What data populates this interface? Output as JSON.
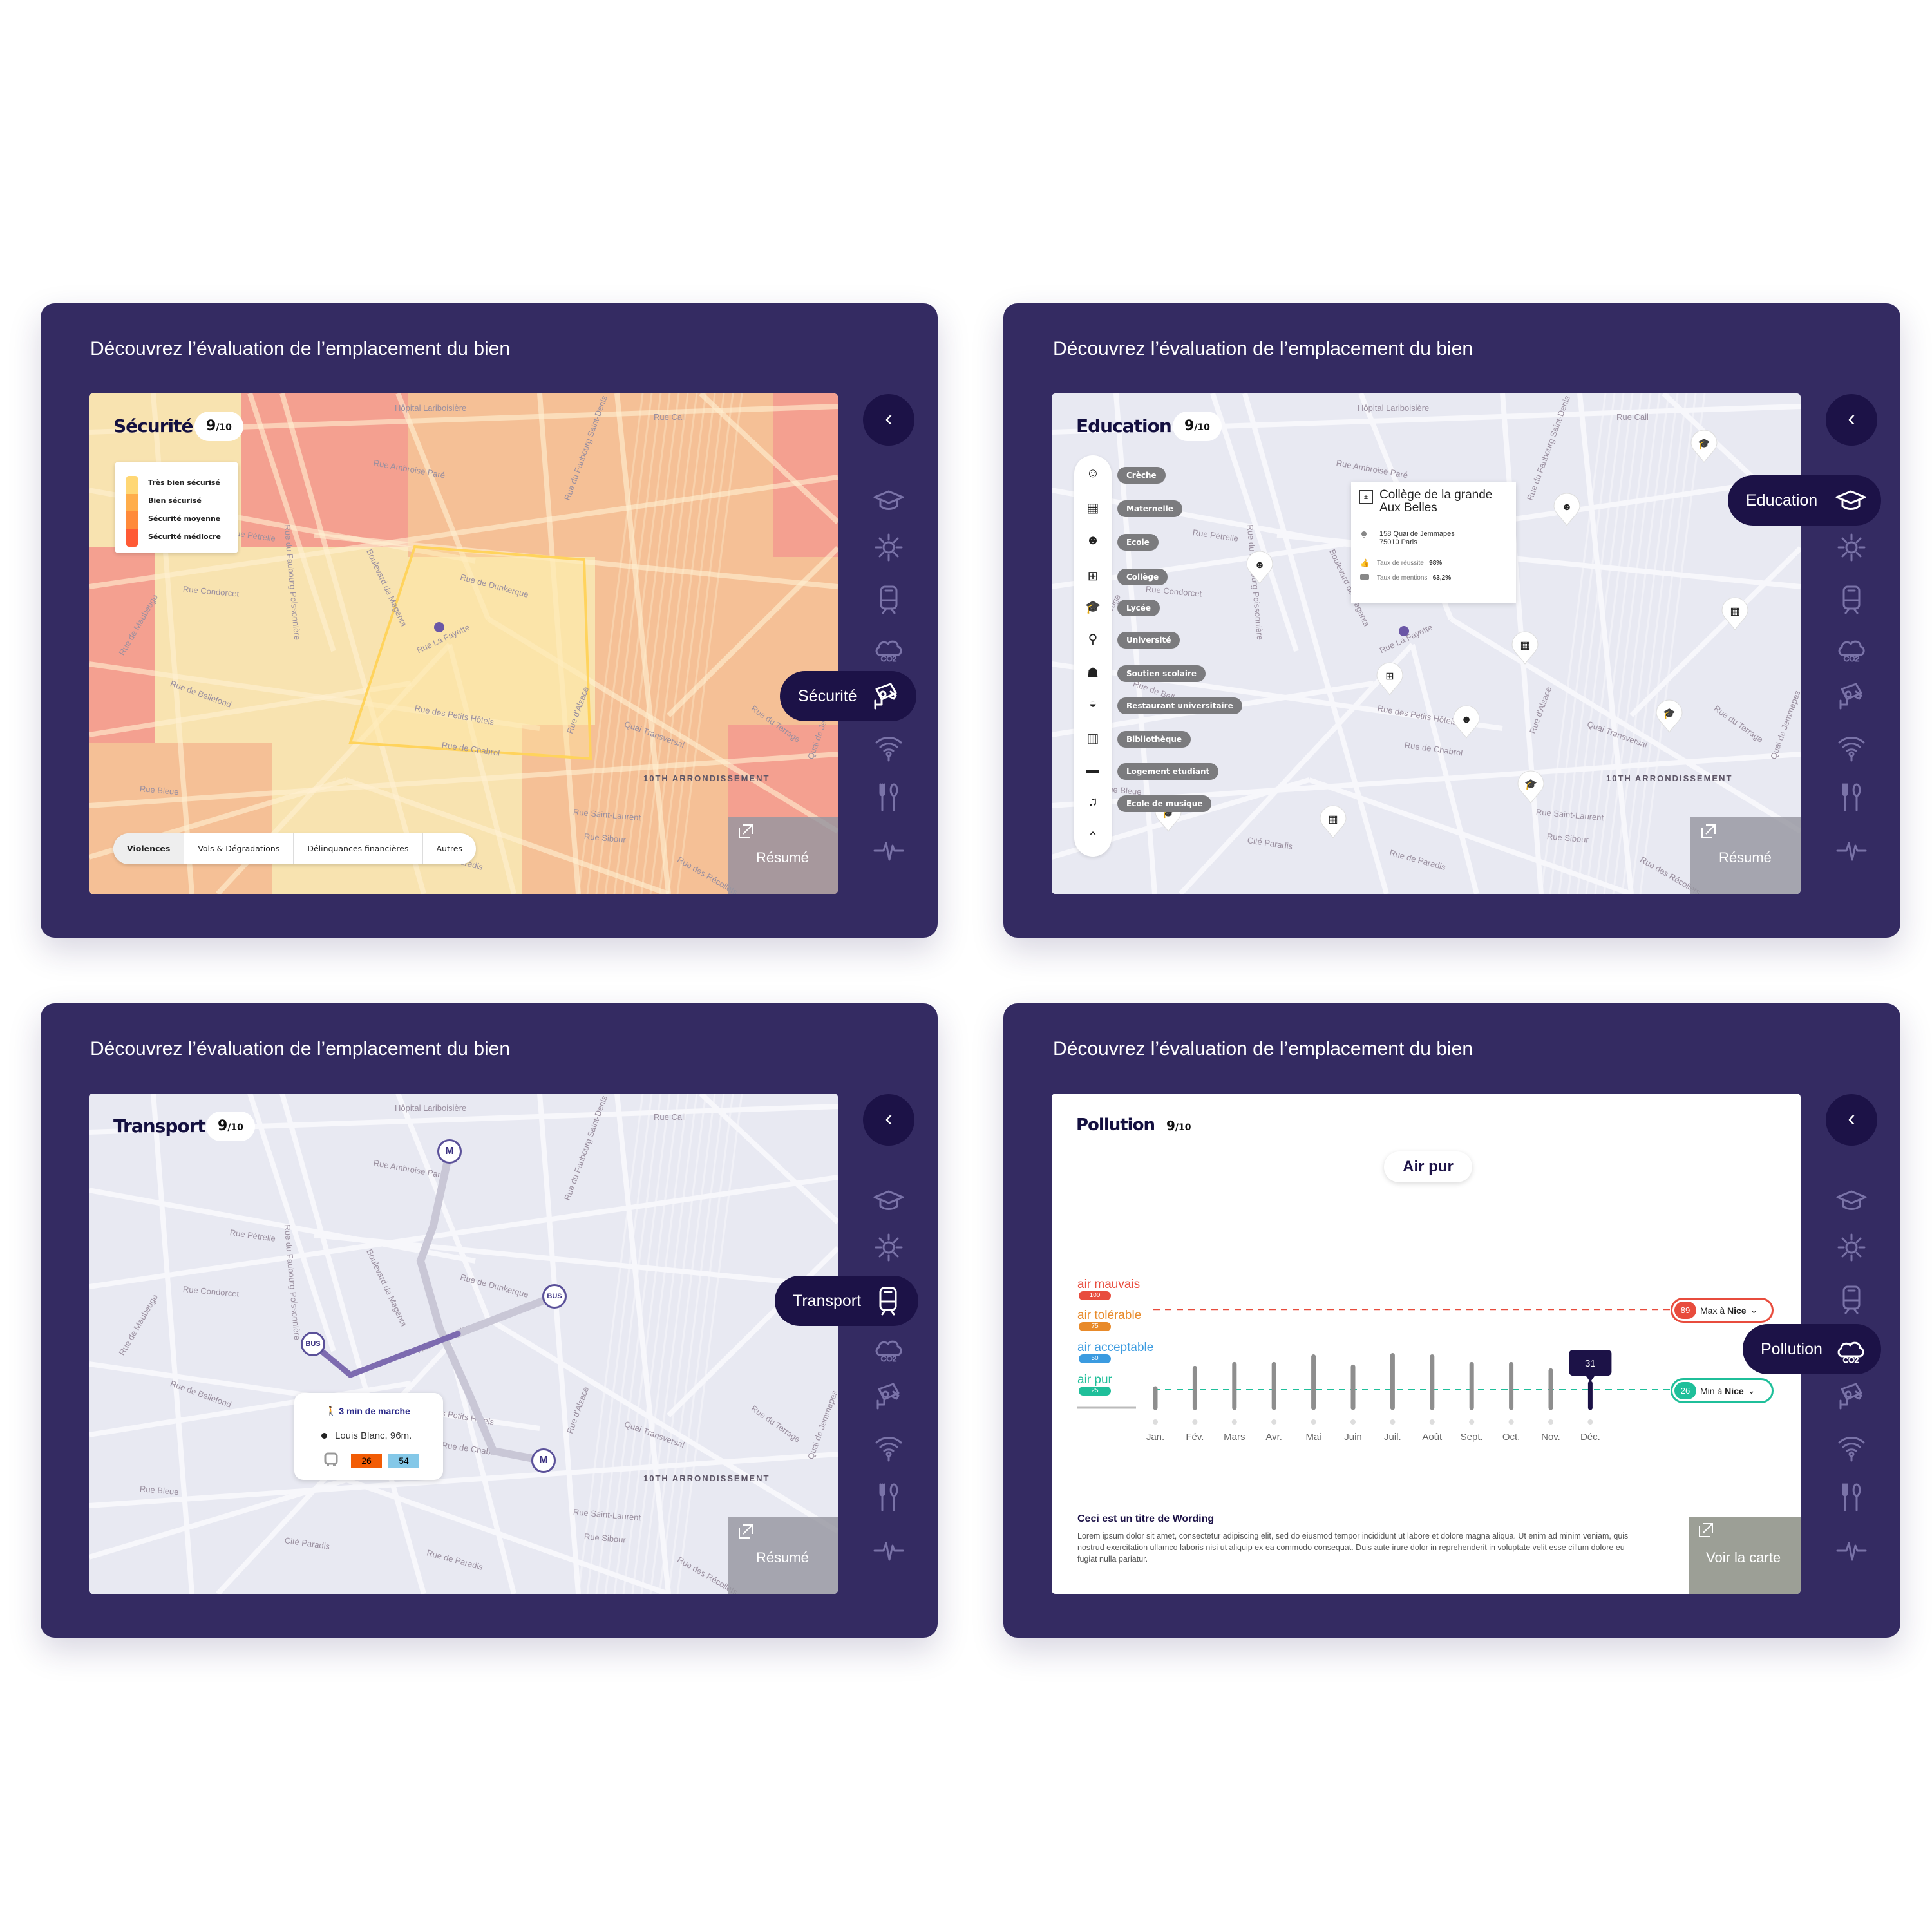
{
  "heading": "Découvrez l’évaluation de l’emplacement du bien",
  "colors": {
    "panel": "#342b62",
    "dark": "#1c1247",
    "icon": "#7a73a8",
    "bad": "#e84c3d",
    "tolerable": "#e88a2a",
    "acceptable": "#3b9be0",
    "pure": "#1fbf9a"
  },
  "sidebar_icons": [
    "graduation-cap-icon",
    "sun-icon",
    "train-icon",
    "cloud-co2-icon",
    "security-camera-icon",
    "wifi-icon",
    "fork-spoon-icon",
    "pulse-icon"
  ],
  "back_label": "‹",
  "resume_label": "Résumé",
  "map_labels": [
    "Hôpital Lariboisière",
    "Rue Ambroise Paré",
    "Boulevard de Magenta",
    "Rue La Fayette",
    "10TH ARRONDISSEMENT",
    "Rue de Chabrol",
    "Rue du Faubourg Poissonnière",
    "Rue Saint-Laurent",
    "Rue Sibour",
    "Rue des Récollets",
    "Rue de Dunkerque",
    "Rue Condorcet",
    "Rue de Maubeuge",
    "Rue de Bellefond",
    "Rue Bleue",
    "Rue des Petits Hôtels",
    "Rue de Paradis",
    "Cité Paradis",
    "Quai de Jemmapes",
    "Rue du Terrage",
    "Quai Transversal",
    "Rue d'Alsace",
    "Rue Cail",
    "Rue du Faubourg Saint-Denis",
    "Rue Pétrelle"
  ],
  "security": {
    "title": "Sécurité",
    "score": "9",
    "score_max": "/10",
    "active": "Sécurité",
    "active_icon": "security-camera-icon",
    "legend": [
      {
        "label": "Très bien sécurisé",
        "color": "#ffd774"
      },
      {
        "label": "Bien sécurisé",
        "color": "#ffad4a"
      },
      {
        "label": "Sécurité moyenne",
        "color": "#ff8a3a"
      },
      {
        "label": "Sécurité médiocre",
        "color": "#ff5a35"
      }
    ],
    "tabs": [
      "Violences",
      "Vols & Dégradations",
      "Délinquances financières",
      "Autres"
    ],
    "active_tab": "Violences"
  },
  "education": {
    "title": "Education",
    "score": "9",
    "score_max": "/10",
    "active": "Education",
    "active_icon": "graduation-cap-icon",
    "filters": [
      {
        "label": "Crèche",
        "icon": "baby-icon"
      },
      {
        "label": "Maternelle",
        "icon": "abc-blocks-icon"
      },
      {
        "label": "Ecole",
        "icon": "children-icon"
      },
      {
        "label": "Collège",
        "icon": "calculator-icon"
      },
      {
        "label": "Lycée",
        "icon": "graduation-cap-icon"
      },
      {
        "label": "Université",
        "icon": "diploma-icon"
      },
      {
        "label": "Soutien scolaire",
        "icon": "teacher-icon"
      },
      {
        "label": "Restaurant universitaire",
        "icon": "burger-icon"
      },
      {
        "label": "Bibliothèque",
        "icon": "books-icon"
      },
      {
        "label": "Logement etudiant",
        "icon": "bed-icon"
      },
      {
        "label": "Ecole de musique",
        "icon": "music-note-icon"
      }
    ],
    "popup": {
      "name": "Collège de la grande Aux Belles",
      "address1": "158 Quai de Jemmapes",
      "address2": "75010 Paris",
      "success_label": "Taux de réussite",
      "success_value": "98%",
      "mentions_label": "Taux de mentions",
      "mentions_value": "63,2%"
    }
  },
  "transport": {
    "title": "Transport",
    "score": "9",
    "score_max": "/10",
    "active": "Transport",
    "active_icon": "train-icon",
    "stops": [
      "M",
      "BUS",
      "BUS",
      "M"
    ],
    "tooltip": {
      "walk": "3 min de marche",
      "stop": "Louis Blanc, 96m.",
      "lines": [
        {
          "label": "26",
          "color": "#f25c05"
        },
        {
          "label": "54",
          "color": "#84c8e8"
        }
      ]
    }
  },
  "pollution": {
    "title": "Pollution",
    "score": "9",
    "score_max": "/10",
    "active": "Pollution",
    "active_icon": "cloud-co2-icon",
    "status": "Air pur",
    "levels": [
      {
        "label": "air mauvais",
        "value": "100",
        "color": "#e84c3d"
      },
      {
        "label": "air tolérable",
        "value": "75",
        "color": "#e88a2a"
      },
      {
        "label": "air acceptable",
        "value": "50",
        "color": "#3b9be0"
      },
      {
        "label": "air pur",
        "value": "25",
        "color": "#1fbf9a"
      }
    ],
    "max": {
      "value": "89",
      "text": "Max à",
      "city": "Nice"
    },
    "min": {
      "value": "26",
      "text": "Min à",
      "city": "Nice"
    },
    "wording_title": "Ceci est un titre de Wording",
    "wording_text": "Lorem ipsum dolor sit amet, consectetur adipiscing elit, sed do eiusmod tempor incididunt ut labore et dolore magna aliqua. Ut enim ad minim veniam, quis nostrud exercitation ullamco laboris nisi ut aliquip ex ea commodo consequat. Duis aute irure dolor in reprehenderit in voluptate velit esse cillum dolore eu fugiat nulla pariatur.",
    "map_link": "Voir la carte"
  },
  "chart_data": {
    "type": "bar",
    "categories": [
      "Jan.",
      "Fév.",
      "Mars",
      "Avr.",
      "Mai",
      "Juin",
      "Juil.",
      "Août",
      "Sept.",
      "Oct.",
      "Nov.",
      "Déc."
    ],
    "values": [
      27,
      43,
      46,
      46,
      52,
      44,
      53,
      52,
      46,
      46,
      41,
      31
    ],
    "highlight": {
      "category": "Déc.",
      "label": "31"
    },
    "reference_lines": [
      {
        "value": 89,
        "color": "#e84c3d"
      },
      {
        "value": 26,
        "color": "#1fbf9a"
      }
    ],
    "ylim": [
      11,
      100
    ]
  }
}
